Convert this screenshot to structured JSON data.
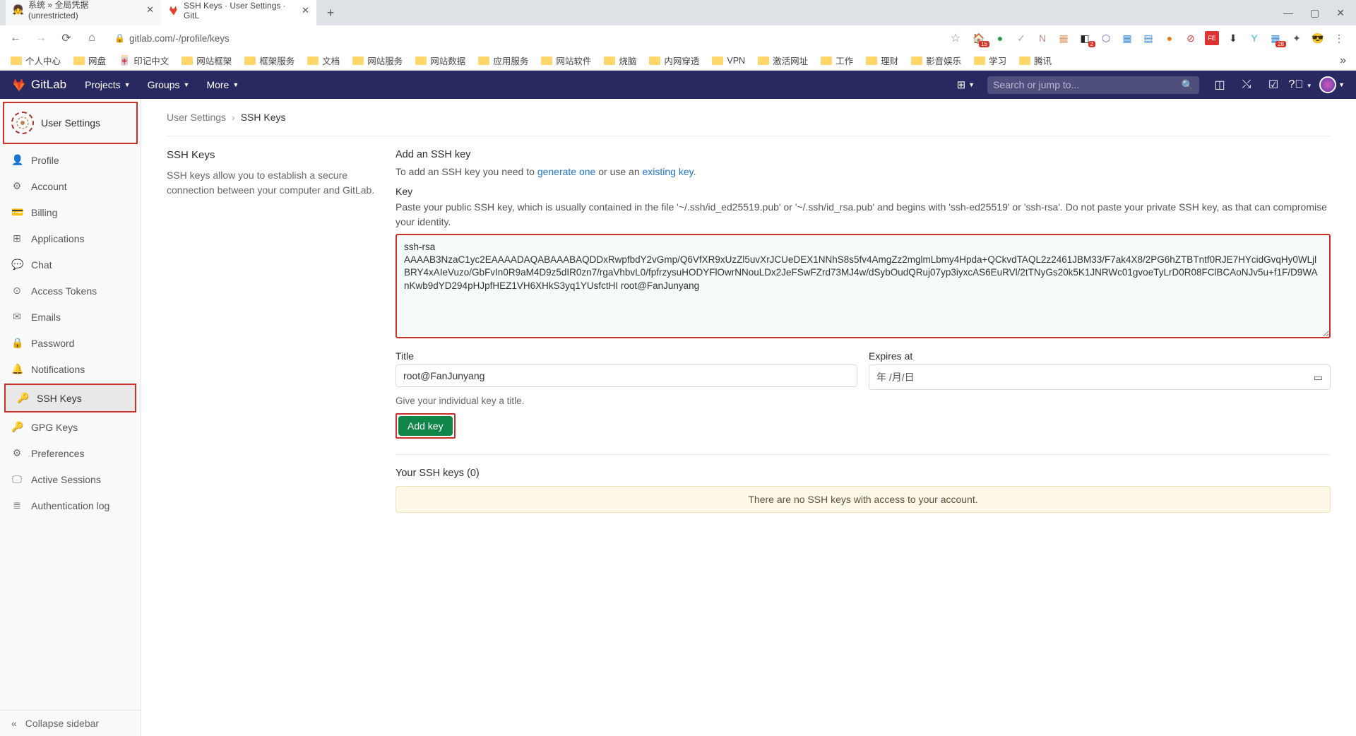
{
  "browser": {
    "tabs": [
      {
        "favicon": "👧",
        "title": "系统 » 全局凭据 (unrestricted)"
      },
      {
        "favicon": "gitlab",
        "title": "SSH Keys · User Settings · GitL"
      }
    ],
    "url": "gitlab.com/-/profile/keys",
    "bookmarks": [
      "个人中心",
      "网盘",
      "印记中文",
      "网站框架",
      "框架服务",
      "文档",
      "网站服务",
      "网站数据",
      "应用服务",
      "网站软件",
      "烧脑",
      "内网穿透",
      "VPN",
      "激活网址",
      "工作",
      "理财",
      "影音娱乐",
      "学习",
      "腾讯"
    ]
  },
  "navbar": {
    "brand": "GitLab",
    "items": [
      "Projects",
      "Groups",
      "More"
    ],
    "search_placeholder": "Search or jump to..."
  },
  "sidebar": {
    "title": "User Settings",
    "items": [
      {
        "icon": "👤",
        "label": "Profile"
      },
      {
        "icon": "⚙",
        "label": "Account"
      },
      {
        "icon": "💳",
        "label": "Billing"
      },
      {
        "icon": "⊞",
        "label": "Applications"
      },
      {
        "icon": "💬",
        "label": "Chat"
      },
      {
        "icon": "⊙",
        "label": "Access Tokens"
      },
      {
        "icon": "✉",
        "label": "Emails"
      },
      {
        "icon": "🔒",
        "label": "Password"
      },
      {
        "icon": "🔔",
        "label": "Notifications"
      },
      {
        "icon": "🔑",
        "label": "SSH Keys"
      },
      {
        "icon": "🔑",
        "label": "GPG Keys"
      },
      {
        "icon": "⚙",
        "label": "Preferences"
      },
      {
        "icon": "🖵",
        "label": "Active Sessions"
      },
      {
        "icon": "≣",
        "label": "Authentication log"
      }
    ],
    "collapse": "Collapse sidebar"
  },
  "breadcrumb": {
    "parent": "User Settings",
    "current": "SSH Keys"
  },
  "description": {
    "heading": "SSH Keys",
    "text": "SSH keys allow you to establish a secure connection between your computer and GitLab."
  },
  "form": {
    "heading": "Add an SSH key",
    "intro_pre": "To add an SSH key you need to ",
    "link1": "generate one",
    "intro_mid": " or use an ",
    "link2": "existing key",
    "intro_end": ".",
    "key_label": "Key",
    "key_help": "Paste your public SSH key, which is usually contained in the file '~/.ssh/id_ed25519.pub' or '~/.ssh/id_rsa.pub' and begins with 'ssh-ed25519' or 'ssh-rsa'. Do not paste your private SSH key, as that can compromise your identity.",
    "key_value": "ssh-rsa AAAAB3NzaC1yc2EAAAADAQABAAABAQDDxRwpfbdY2vGmp/Q6VfXR9xUzZl5uvXrJCUeDEX1NNhS8s5fv4AmgZz2mglmLbmy4Hpda+QCkvdTAQL2z2461JBM33/F7ak4X8/2PG6hZTBTntf0RJE7HYcidGvqHy0WLjlBRY4xAIeVuzo/GbFvIn0R9aM4D9z5dIR0zn7/rgaVhbvL0/fpfrzysuHODYFlOwrNNouLDx2JeFSwFZrd73MJ4w/dSybOudQRuj07yp3iyxcAS6EuRVl/2tTNyGs20k5K1JNRWc01gvoeTyLrD0R08FClBCAoNJv5u+f1F/D9WAnKwb9dYD294pHJpfHEZ1VH6XHkS3yq1YUsfctHI root@FanJunyang",
    "title_label": "Title",
    "title_value": "root@FanJunyang",
    "expires_label": "Expires at",
    "expires_placeholder": "年 /月/日",
    "title_hint": "Give your individual key a title.",
    "submit": "Add key"
  },
  "keys_list": {
    "heading": "Your SSH keys (0)",
    "empty": "There are no SSH keys with access to your account."
  }
}
